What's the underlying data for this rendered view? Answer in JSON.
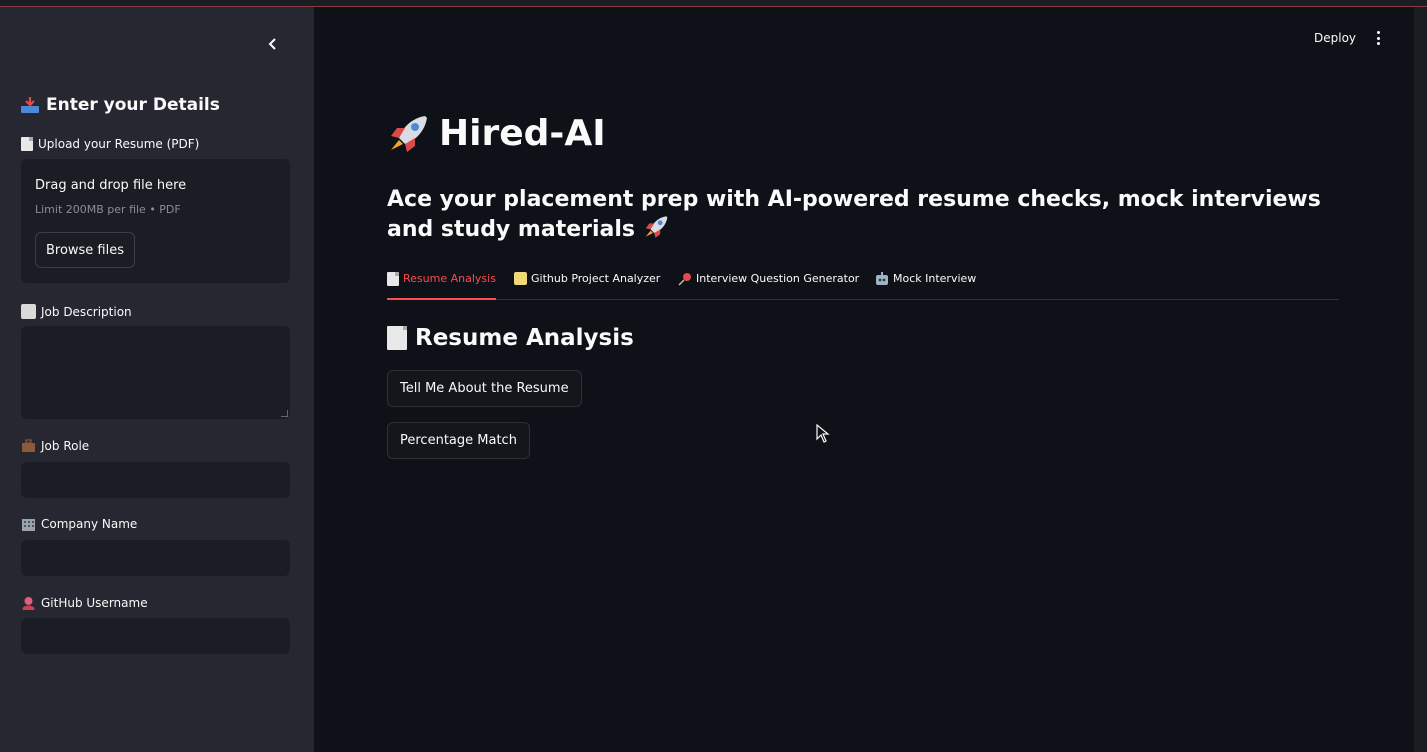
{
  "header": {
    "deploy_label": "Deploy"
  },
  "sidebar": {
    "heading": "Enter your Details",
    "upload": {
      "label": "Upload your Resume (PDF)",
      "drop_text": "Drag and drop file here",
      "limit_text": "Limit 200MB per file • PDF",
      "browse_label": "Browse files"
    },
    "job_description": {
      "label": "Job Description",
      "value": ""
    },
    "job_role": {
      "label": "Job Role",
      "value": ""
    },
    "company_name": {
      "label": "Company Name",
      "value": ""
    },
    "github_username": {
      "label": "GitHub Username",
      "value": ""
    }
  },
  "main": {
    "title": "Hired-AI",
    "subtitle": "Ace your placement prep with AI-powered resume checks, mock interviews and study materials",
    "tabs": [
      {
        "label": "Resume Analysis",
        "active": true
      },
      {
        "label": "Github Project Analyzer",
        "active": false
      },
      {
        "label": "Interview Question Generator",
        "active": false
      },
      {
        "label": "Mock Interview",
        "active": false
      }
    ],
    "section_title": "Resume Analysis",
    "buttons": {
      "tell_me": "Tell Me About the Resume",
      "percentage_match": "Percentage Match"
    }
  },
  "colors": {
    "background": "#0e1117",
    "sidebar": "#262730",
    "accent": "#ff4b4b",
    "input_bg": "#1b1d24"
  }
}
